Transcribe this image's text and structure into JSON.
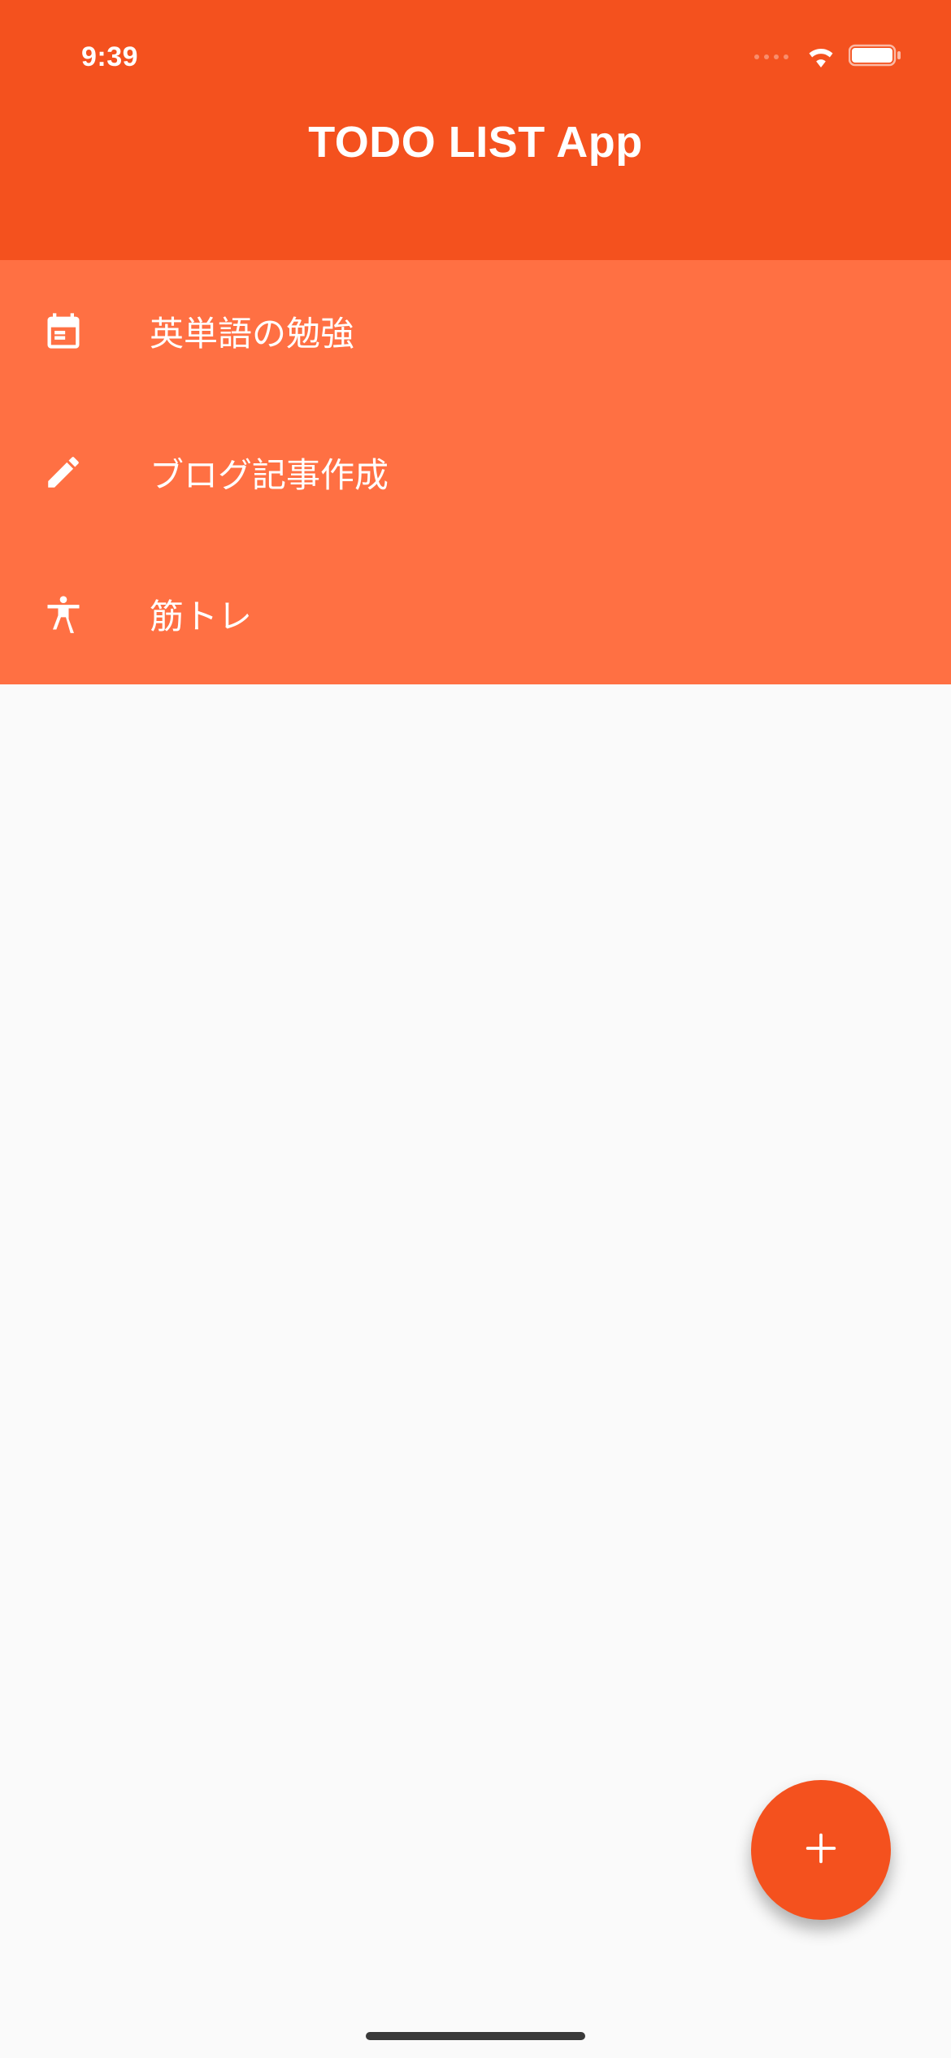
{
  "status_bar": {
    "time": "9:39"
  },
  "app_bar": {
    "title": "TODO LIST App"
  },
  "todo_items": [
    {
      "icon": "calendar-event-icon",
      "label": "英単語の勉強"
    },
    {
      "icon": "edit-pencil-icon",
      "label": "ブログ記事作成"
    },
    {
      "icon": "accessibility-icon",
      "label": "筋トレ"
    }
  ],
  "fab": {
    "icon": "plus-icon"
  },
  "colors": {
    "app_bar": "#f4511e",
    "list_item": "#ff7043",
    "fab": "#f4511e"
  }
}
